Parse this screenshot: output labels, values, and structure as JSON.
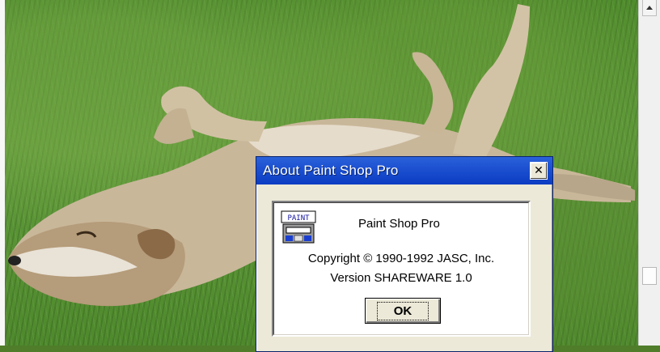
{
  "dialog": {
    "title": "About Paint Shop Pro",
    "close_glyph": "✕",
    "app_name": "Paint Shop Pro",
    "copyright": "Copyright © 1990-1992 JASC, Inc.",
    "version": "Version SHAREWARE 1.0",
    "ok_label": "OK",
    "icon_text": "PAINT"
  },
  "colors": {
    "titlebar": "#1b4fd0",
    "dialog_face": "#ece9d8",
    "panel_bg": "#ffffff"
  }
}
